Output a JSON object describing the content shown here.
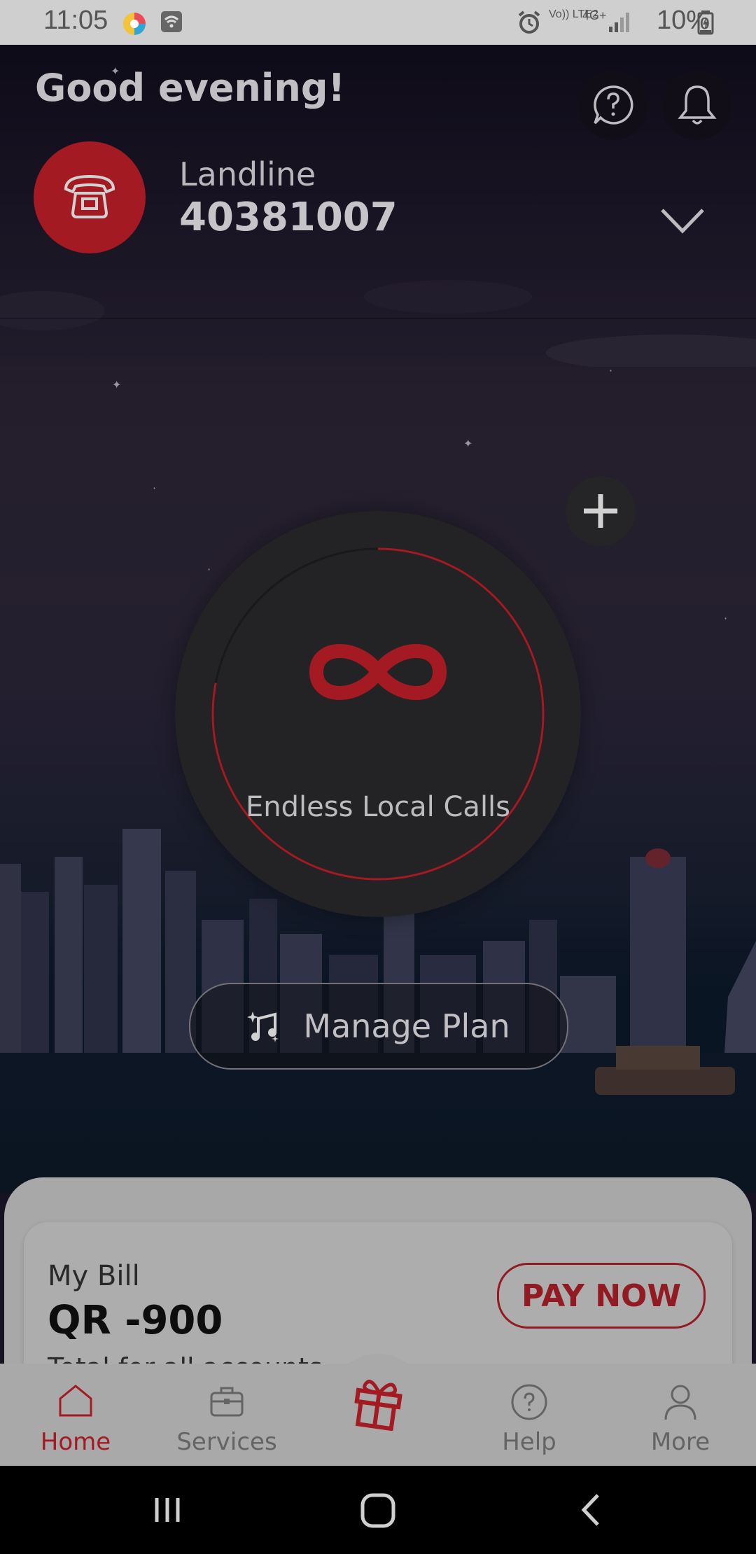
{
  "status_bar": {
    "time": "11:05",
    "network_label": "Vo)) LTE2",
    "network_type": "4G+",
    "battery": "10%"
  },
  "header": {
    "greeting": "Good evening!",
    "help_icon": "question-circle-icon",
    "notifications_icon": "bell-icon"
  },
  "account": {
    "type": "Landline",
    "number": "40381007",
    "icon": "telephone-icon"
  },
  "plan": {
    "label": "Endless Local Calls",
    "icon": "infinity-icon",
    "progress_fraction": 0.22,
    "accent_color": "#c8202a"
  },
  "actions": {
    "manage_plan_label": "Manage Plan"
  },
  "bill": {
    "title": "My Bill",
    "amount": "QR -900",
    "subtitle": "Total for all accounts",
    "pay_now_label": "PAY NOW"
  },
  "tabs": [
    {
      "label": "Home",
      "icon": "home-icon",
      "active": true
    },
    {
      "label": "Services",
      "icon": "briefcase-icon",
      "active": false
    },
    {
      "label": "",
      "icon": "gift-icon",
      "active": false
    },
    {
      "label": "Help",
      "icon": "help-icon",
      "active": false
    },
    {
      "label": "More",
      "icon": "person-icon",
      "active": false
    }
  ],
  "colors": {
    "brand_red": "#c8202a",
    "inactive_gray": "#7a7a7a"
  }
}
